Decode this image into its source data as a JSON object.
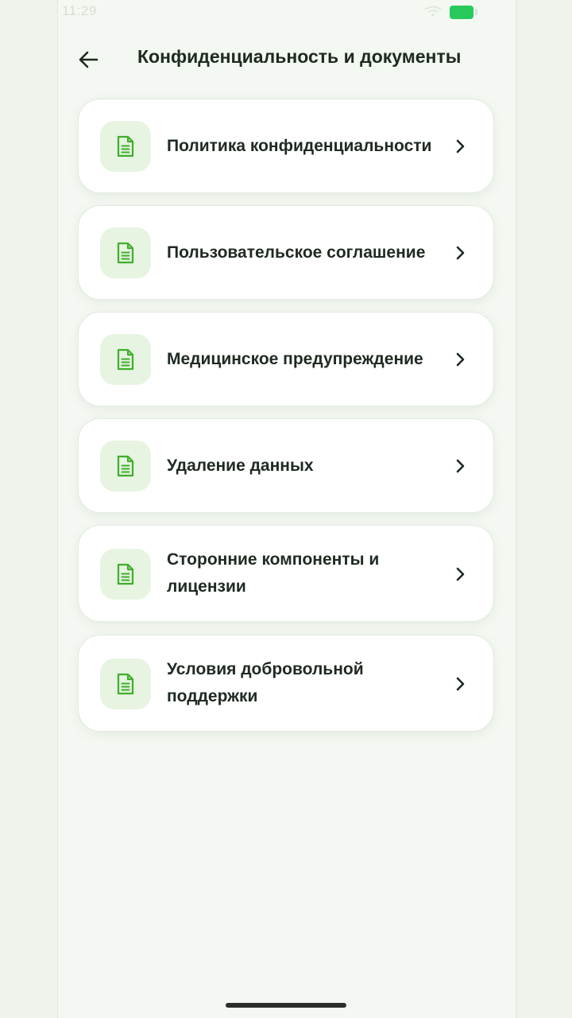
{
  "status_bar": {
    "time": "11:29"
  },
  "header": {
    "title": "Конфиденциальность и документы"
  },
  "documents": [
    {
      "label": "Политика конфиденциальности",
      "icon": "document-icon"
    },
    {
      "label": "Пользовательское соглашение",
      "icon": "document-icon"
    },
    {
      "label": "Медицинское предупреждение",
      "icon": "document-icon"
    },
    {
      "label": "Удаление данных",
      "icon": "document-icon"
    },
    {
      "label": "Сторонние компоненты и лицензии",
      "icon": "document-icon"
    },
    {
      "label": "Условия добровольной поддержки",
      "icon": "document-icon"
    }
  ],
  "colors": {
    "accent": "#3fae2a",
    "icon_bg": "#e6f4e1",
    "battery": "#27c95a",
    "background": "#f4f8f2"
  }
}
